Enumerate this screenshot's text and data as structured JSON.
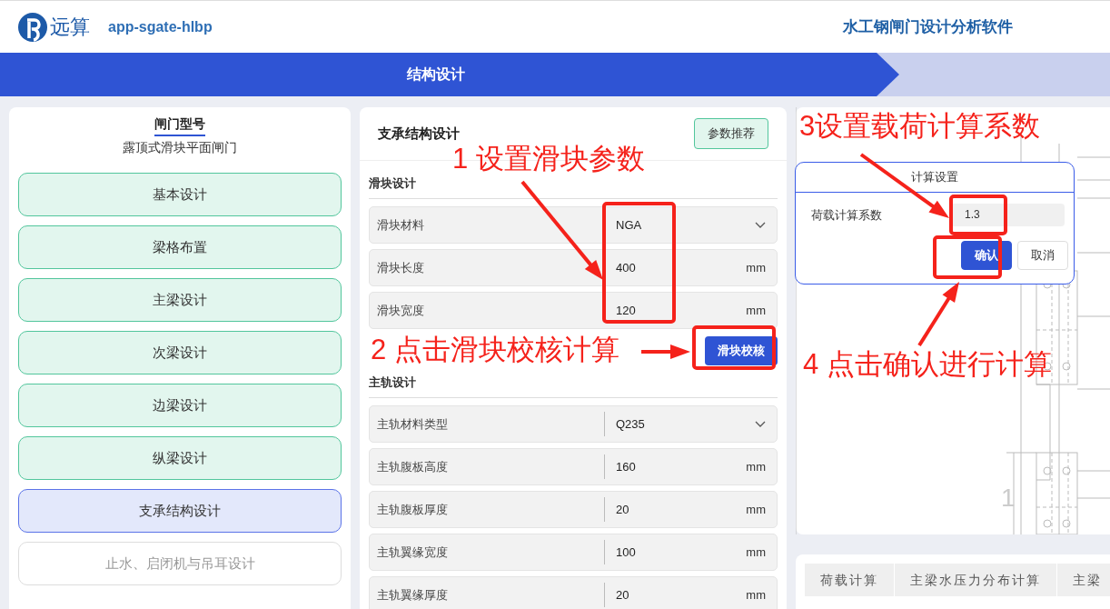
{
  "header": {
    "logo_text": "远算",
    "app_name": "app-sgate-hlbp",
    "title": "水工钢闸门设计分析软件"
  },
  "steps": [
    {
      "label": "结构设计",
      "selected": true
    }
  ],
  "sidebar": {
    "title": "闸门型号",
    "subtitle": "露顶式滑块平面闸门",
    "items": [
      {
        "label": "基本设计",
        "kind": "done"
      },
      {
        "label": "梁格布置",
        "kind": "done"
      },
      {
        "label": "主梁设计",
        "kind": "done"
      },
      {
        "label": "次梁设计",
        "kind": "done"
      },
      {
        "label": "边梁设计",
        "kind": "done"
      },
      {
        "label": "纵梁设计",
        "kind": "done"
      },
      {
        "label": "支承结构设计",
        "kind": "active"
      },
      {
        "label": "止水、启闭机与吊耳设计",
        "kind": "locked"
      }
    ]
  },
  "support": {
    "title": "支承结构设计",
    "recommend_button": "参数推荐",
    "sections": [
      {
        "title": "滑块设计",
        "action": "滑块校核",
        "fields": [
          {
            "label": "滑块材料",
            "kind": "select",
            "value": "NGA"
          },
          {
            "label": "滑块长度",
            "kind": "number",
            "value": "400",
            "unit": "mm"
          },
          {
            "label": "滑块宽度",
            "kind": "number",
            "value": "120",
            "unit": "mm"
          }
        ]
      },
      {
        "title": "主轨设计",
        "fields": [
          {
            "label": "主轨材料类型",
            "kind": "select",
            "value": "Q235"
          },
          {
            "label": "主轨腹板高度",
            "kind": "number",
            "value": "160",
            "unit": "mm"
          },
          {
            "label": "主轨腹板厚度",
            "kind": "number",
            "value": "20",
            "unit": "mm"
          },
          {
            "label": "主轨翼缘宽度",
            "kind": "number",
            "value": "100",
            "unit": "mm"
          },
          {
            "label": "主轨翼缘厚度",
            "kind": "number",
            "value": "20",
            "unit": "mm"
          }
        ]
      }
    ]
  },
  "drawing": {
    "label": "1"
  },
  "dialog": {
    "title": "计算设置",
    "field_label": "荷载计算系数",
    "value": "1.3",
    "buttons": [
      {
        "label": "确认",
        "kind": "primary"
      },
      {
        "label": "取消",
        "kind": "default"
      }
    ]
  },
  "result_tabs": [
    {
      "label": "荷载计算"
    },
    {
      "label": "主梁水压力分布计算"
    },
    {
      "label": "主梁"
    }
  ],
  "annotations": [
    {
      "text": "1 设置滑块参数"
    },
    {
      "text": "2 点击滑块校核计算"
    },
    {
      "text": "3设置载荷计算系数"
    },
    {
      "text": "4 点击确认进行计算"
    }
  ]
}
